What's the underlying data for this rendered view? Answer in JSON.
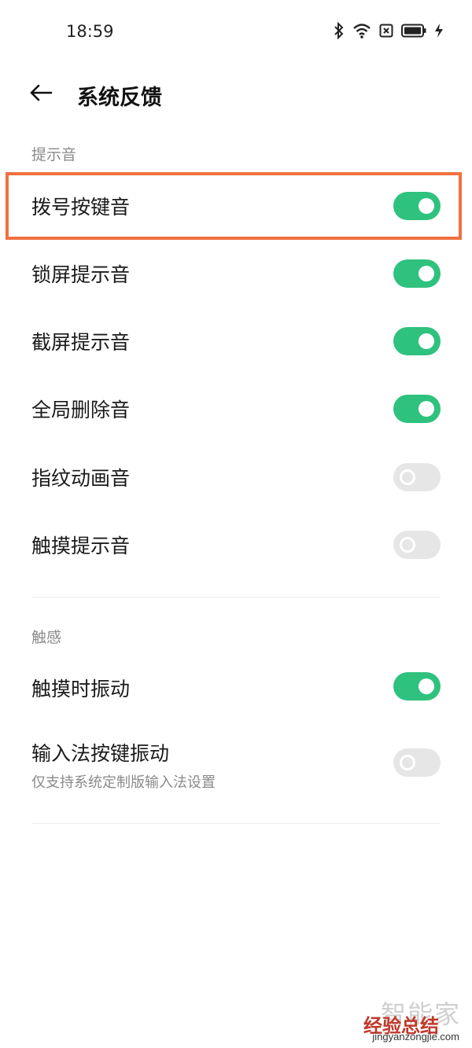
{
  "status_bar": {
    "time": "18:59",
    "icons": [
      "bluetooth-icon",
      "wifi-icon",
      "no-sim-icon",
      "battery-icon",
      "charging-icon"
    ]
  },
  "app_bar": {
    "back_icon": "arrow-left-icon",
    "title": "系统反馈"
  },
  "sections": [
    {
      "header": "提示音",
      "items": [
        {
          "label": "拨号按键音",
          "on": true
        },
        {
          "label": "锁屏提示音",
          "on": true
        },
        {
          "label": "截屏提示音",
          "on": true
        },
        {
          "label": "全局删除音",
          "on": true
        },
        {
          "label": "指纹动画音",
          "on": false
        },
        {
          "label": "触摸提示音",
          "on": false
        }
      ]
    },
    {
      "header": "触感",
      "items": [
        {
          "label": "触摸时振动",
          "on": true
        },
        {
          "label": "输入法按键振动",
          "subtitle": "仅支持系统定制版输入法设置",
          "on": false
        }
      ]
    }
  ],
  "colors": {
    "toggle_on": "#2ec27e",
    "toggle_off": "#e6e6e6",
    "highlight": "#f07040"
  },
  "watermark": {
    "line1": "智能家",
    "line2": "经验总结",
    "line3": "jingyanzongjie.com"
  }
}
